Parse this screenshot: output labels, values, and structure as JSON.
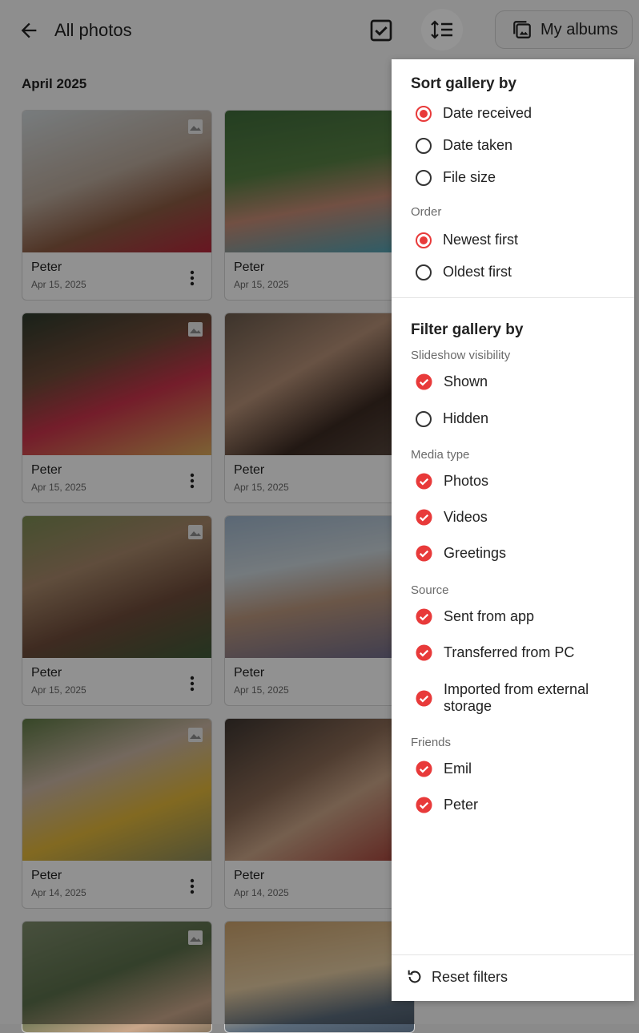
{
  "header": {
    "title": "All photos",
    "albums_label": "My albums"
  },
  "gallery": {
    "month": "April 2025",
    "cards": [
      {
        "name": "Peter",
        "date": "Apr 15, 2025"
      },
      {
        "name": "Peter",
        "date": "Apr 15, 2025"
      },
      {
        "name": "Peter",
        "date": "Apr 15, 2025"
      },
      {
        "name": "Peter",
        "date": "Apr 15, 2025"
      },
      {
        "name": "Peter",
        "date": "Apr 15, 2025"
      },
      {
        "name": "Peter",
        "date": "Apr 15, 2025"
      },
      {
        "name": "Peter",
        "date": "Apr 14, 2025"
      },
      {
        "name": "Peter",
        "date": "Apr 14, 2025"
      }
    ]
  },
  "panel": {
    "sort_title": "Sort gallery by",
    "sort_options": [
      {
        "label": "Date received",
        "selected": true
      },
      {
        "label": "Date taken",
        "selected": false
      },
      {
        "label": "File size",
        "selected": false
      }
    ],
    "order_title": "Order",
    "order_options": [
      {
        "label": "Newest first",
        "selected": true
      },
      {
        "label": "Oldest first",
        "selected": false
      }
    ],
    "filter_title": "Filter gallery by",
    "visibility_title": "Slideshow visibility",
    "visibility_options": [
      {
        "label": "Shown",
        "checked": true
      },
      {
        "label": "Hidden",
        "checked": false
      }
    ],
    "media_title": "Media type",
    "media_options": [
      {
        "label": "Photos",
        "checked": true
      },
      {
        "label": "Videos",
        "checked": true
      },
      {
        "label": "Greetings",
        "checked": true
      }
    ],
    "source_title": "Source",
    "source_options": [
      {
        "label": "Sent from app",
        "checked": true
      },
      {
        "label": "Transferred from PC",
        "checked": true
      },
      {
        "label": "Imported from external storage",
        "checked": true
      }
    ],
    "friends_title": "Friends",
    "friends_options": [
      {
        "label": "Emil",
        "checked": true
      },
      {
        "label": "Peter",
        "checked": true
      }
    ],
    "reset_label": "Reset filters"
  },
  "colors": {
    "accent": "#e83a3a"
  }
}
